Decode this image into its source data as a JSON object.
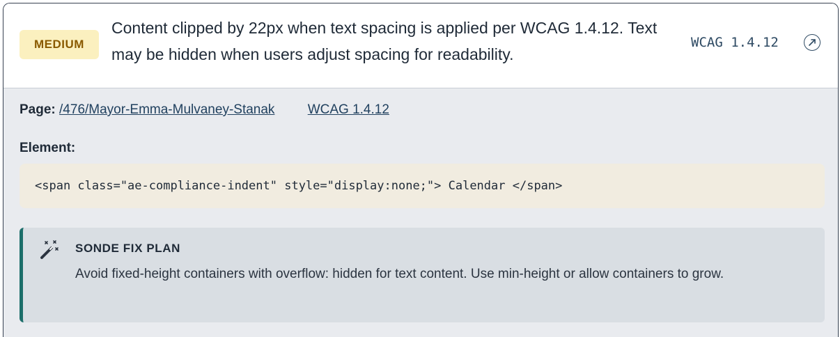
{
  "issue": {
    "severity": "MEDIUM",
    "summary": "Content clipped by 22px when text spacing is applied per WCAG 1.4.12. Text may be hidden when users adjust spacing for readability.",
    "criterion": "WCAG 1.4.12"
  },
  "details": {
    "page_label": "Page:",
    "page_path": "/476/Mayor-Emma-Mulvaney-Stanak",
    "criterion_link": "WCAG 1.4.12",
    "element_label": "Element:",
    "element_code": "<span class=\"ae-compliance-indent\" style=\"display:none;\"> Calendar </span>"
  },
  "fix_plan": {
    "title": "SONDE FIX PLAN",
    "body": "Avoid fixed-height containers with overflow: hidden for text content. Use min-height or allow containers to grow."
  },
  "colors": {
    "severity_bg": "#fbf0bf",
    "severity_text": "#8a5a00",
    "fix_accent": "#1c6e6a",
    "code_bg": "#f1ece0"
  },
  "icons": {
    "criterion_link": "external-link-icon",
    "fix_plan": "magic-wand-icon"
  }
}
